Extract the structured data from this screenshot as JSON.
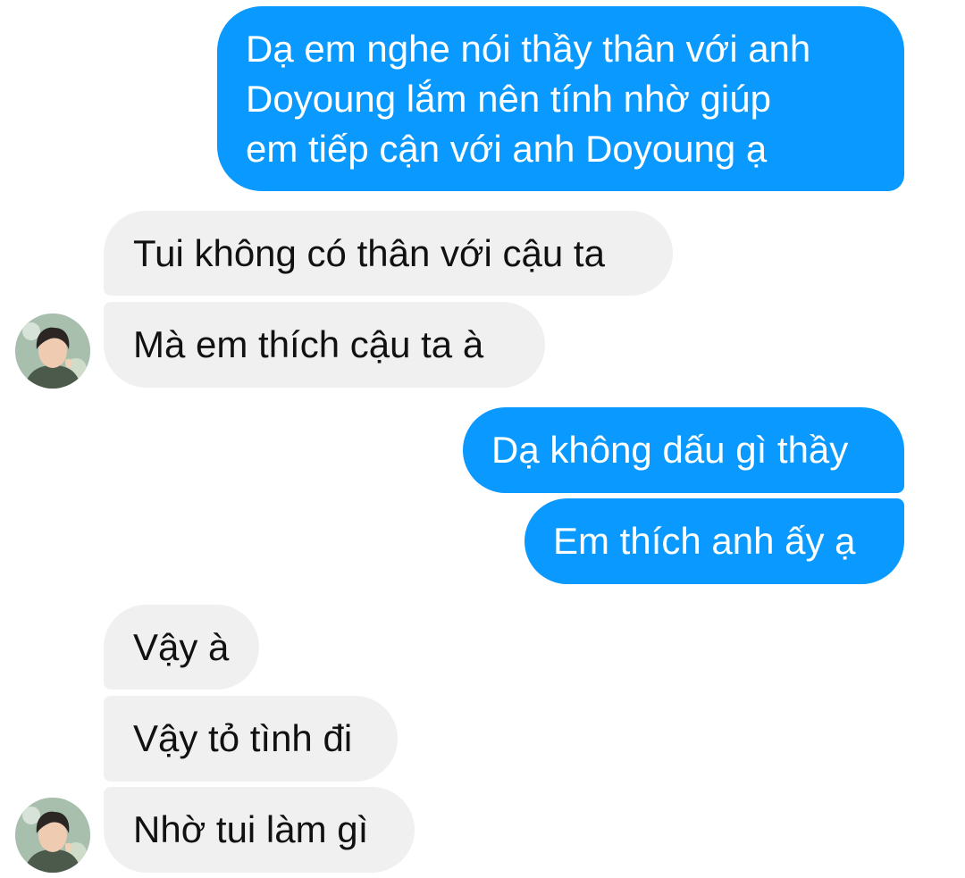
{
  "messages": [
    {
      "sender": "me",
      "lines": [
        "Dạ em nghe nói thầy thân với anh",
        "Doyoung lắm nên tính nhờ giúp",
        "em tiếp cận với anh Doyoung ạ"
      ]
    },
    {
      "sender": "them",
      "text": "Tui không có thân với cậu ta"
    },
    {
      "sender": "them",
      "text": "Mà em thích cậu ta à"
    },
    {
      "sender": "me",
      "text": "Dạ không dấu gì thầy"
    },
    {
      "sender": "me",
      "text": "Em thích anh ấy ạ"
    },
    {
      "sender": "them",
      "text": "Vậy à"
    },
    {
      "sender": "them",
      "text": "Vậy tỏ tình đi"
    },
    {
      "sender": "them",
      "text": "Nhờ tui làm gì"
    }
  ],
  "colors": {
    "sent_bubble": "#0a99ff",
    "received_bubble": "#f0f0f0",
    "sent_text": "#ffffff",
    "received_text": "#111111"
  },
  "avatar": {
    "icon": "profile-photo-avatar"
  }
}
